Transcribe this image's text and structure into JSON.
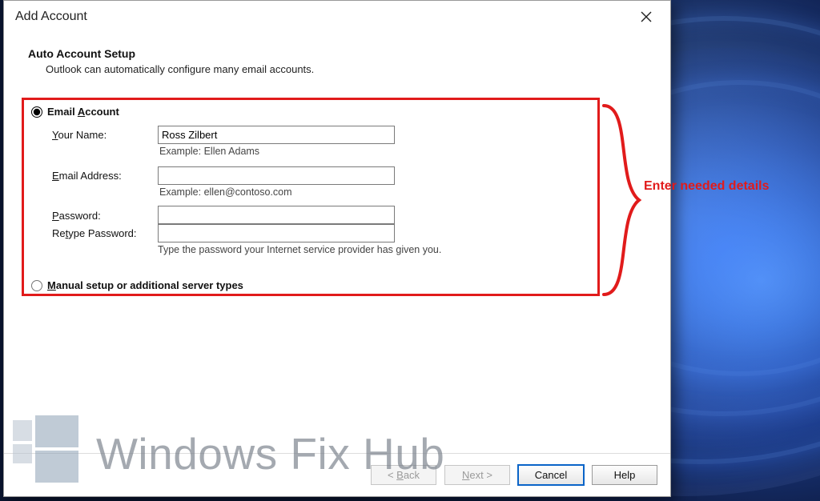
{
  "window": {
    "title": "Add Account"
  },
  "header": {
    "title": "Auto Account Setup",
    "subtitle": "Outlook can automatically configure many email accounts."
  },
  "radios": {
    "email_account_label": "Email Account",
    "manual_label": "Manual setup or additional server types"
  },
  "form": {
    "name_label": "Your Name:",
    "name_value": "Ross Zilbert",
    "name_hint": "Example: Ellen Adams",
    "email_label": "Email Address:",
    "email_value": "",
    "email_hint": "Example: ellen@contoso.com",
    "password_label": "Password:",
    "password_value": "",
    "retype_label": "Retype Password:",
    "retype_value": "",
    "password_hint": "Type the password your Internet service provider has given you."
  },
  "annotation": {
    "text": "Enter needed details",
    "color": "#e11b1b"
  },
  "buttons": {
    "back": "< Back",
    "next": "Next >",
    "cancel": "Cancel",
    "help": "Help"
  },
  "watermark": {
    "text": "Windows Fix Hub"
  }
}
